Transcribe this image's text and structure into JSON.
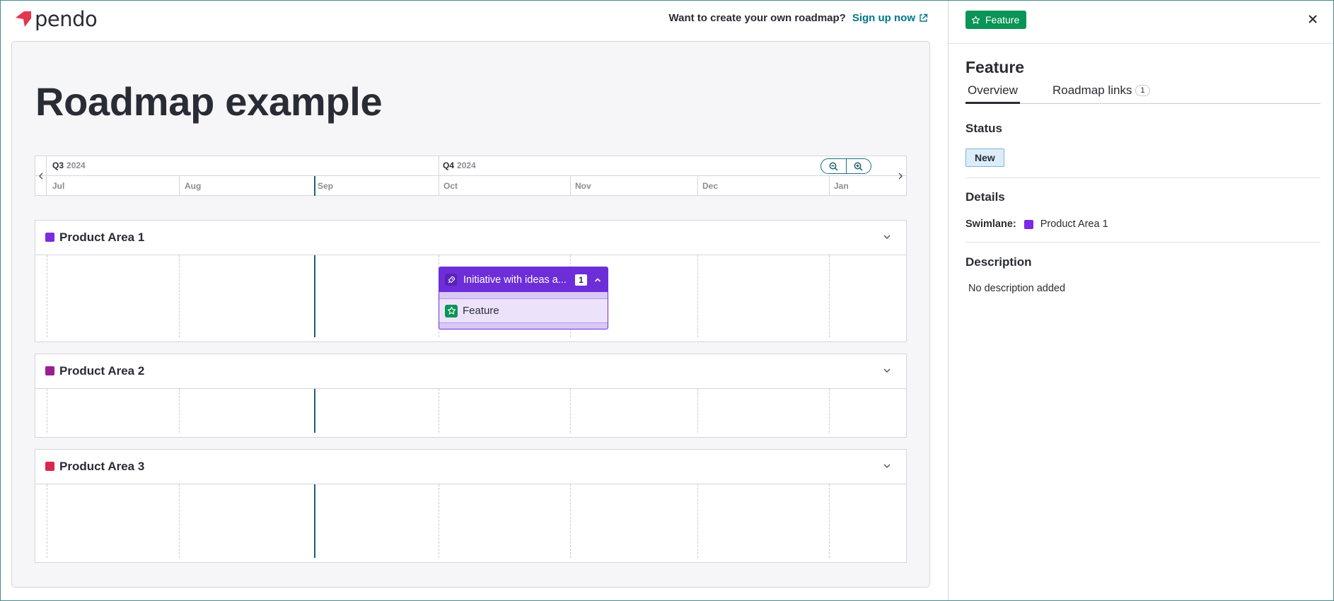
{
  "brand": {
    "name": "pendo",
    "color": "#e5354f"
  },
  "header": {
    "cta_text": "Want to create your own roadmap?",
    "cta_link": "Sign up now"
  },
  "page": {
    "title": "Roadmap example"
  },
  "timeline": {
    "quarters": [
      {
        "label": "Q3",
        "year": "2024"
      },
      {
        "label": "Q4",
        "year": "2024"
      }
    ],
    "months": [
      "Jul",
      "Aug",
      "Sep",
      "Oct",
      "Nov",
      "Dec",
      "Jan"
    ],
    "today_color": "#1f5f73"
  },
  "swimlanes": [
    {
      "name": "Product Area 1",
      "color": "#7b2be0"
    },
    {
      "name": "Product Area 2",
      "color": "#9c1f8f"
    },
    {
      "name": "Product Area 3",
      "color": "#d8284f"
    }
  ],
  "initiative": {
    "title": "Initiative with ideas a...",
    "count": "1",
    "color": "#6d2ed8",
    "icon": "rocket-icon",
    "items": [
      {
        "label": "Feature",
        "icon": "star-icon",
        "color": "#0a9455"
      }
    ]
  },
  "panel": {
    "type_badge": "Feature",
    "title": "Feature",
    "tabs": [
      {
        "label": "Overview",
        "active": true
      },
      {
        "label": "Roadmap links",
        "count": "1"
      }
    ],
    "status": {
      "heading": "Status",
      "value": "New"
    },
    "details": {
      "heading": "Details",
      "swimlane_key": "Swimlane:",
      "swimlane_value": "Product Area 1",
      "swimlane_color": "#7b2be0"
    },
    "description": {
      "heading": "Description",
      "text": "No description added"
    }
  }
}
